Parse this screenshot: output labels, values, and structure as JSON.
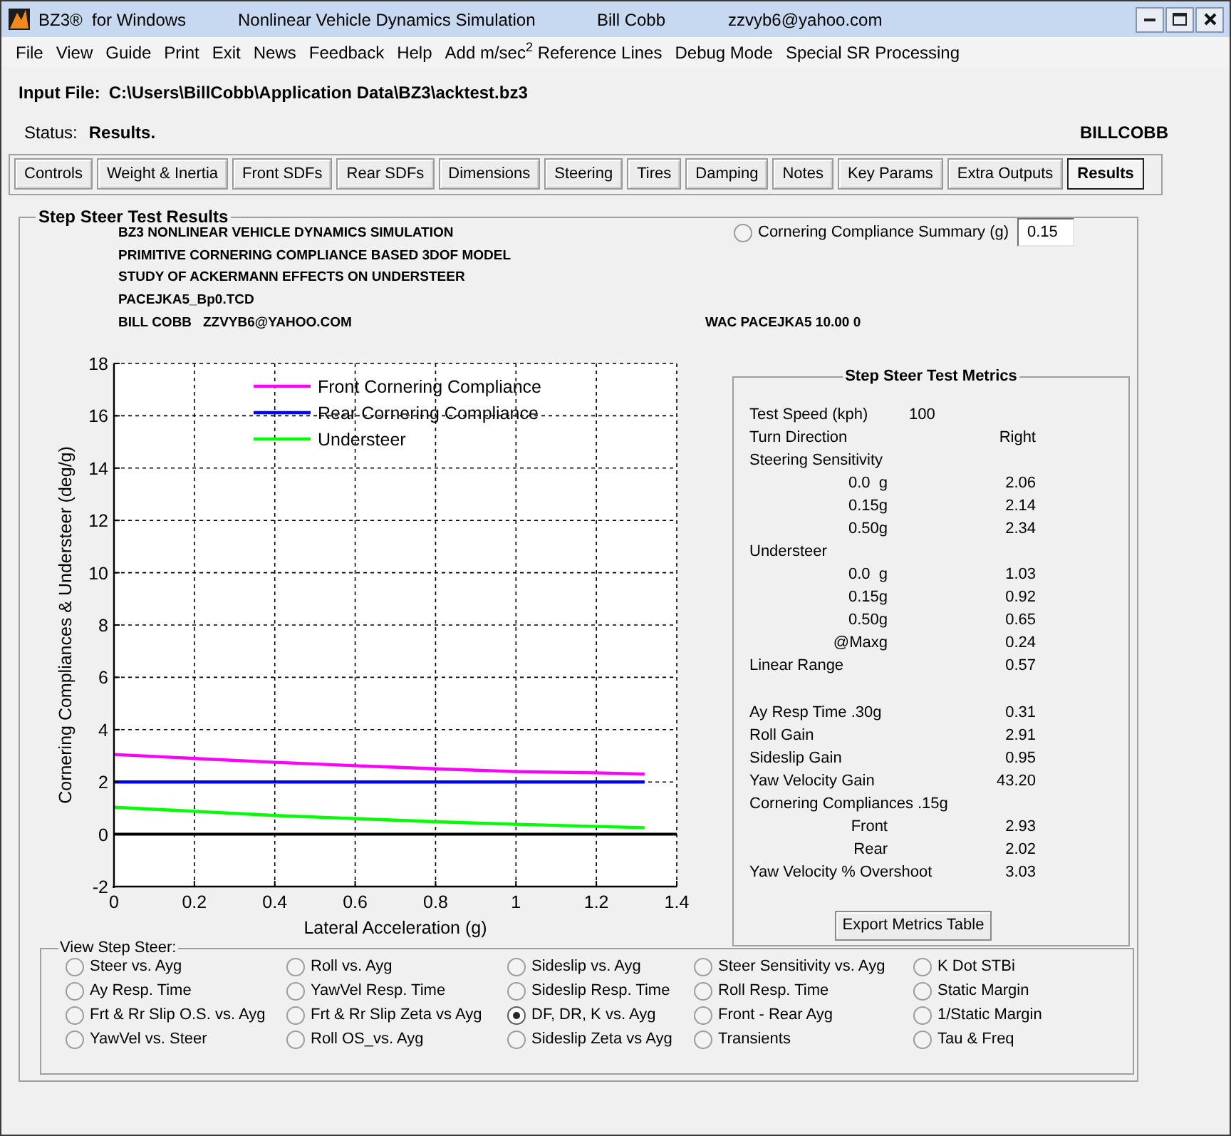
{
  "window": {
    "title_parts": [
      "BZ3®  for Windows",
      "Nonlinear Vehicle Dynamics Simulation",
      "Bill Cobb",
      "zzvyb6@yahoo.com"
    ]
  },
  "menu": [
    "File",
    "View",
    "Guide",
    "Print",
    "Exit",
    "News",
    "Feedback",
    "Help",
    "Add m/sec$^{2}$ Reference Lines",
    "Debug Mode",
    "Special SR Processing"
  ],
  "input_file": {
    "label": "Input File:",
    "path": "C:\\Users\\BillCobb\\Application Data\\BZ3\\acktest.bz3"
  },
  "status": {
    "label": "Status:",
    "value": "Results.",
    "user": "BILLCOBB"
  },
  "tabs": [
    {
      "label": "Controls",
      "selected": false
    },
    {
      "label": "Weight & Inertia",
      "selected": false
    },
    {
      "label": "Front SDFs",
      "selected": false
    },
    {
      "label": "Rear SDFs",
      "selected": false
    },
    {
      "label": "Dimensions",
      "selected": false
    },
    {
      "label": "Steering",
      "selected": false
    },
    {
      "label": "Tires",
      "selected": false
    },
    {
      "label": "Damping",
      "selected": false
    },
    {
      "label": "Notes",
      "selected": false
    },
    {
      "label": "Key Params",
      "selected": false
    },
    {
      "label": "Extra Outputs",
      "selected": false
    },
    {
      "label": "Results",
      "selected": true
    }
  ],
  "results_panel": {
    "title": "Step Steer Test Results",
    "header_lines": [
      "BZ3 NONLINEAR VEHICLE DYNAMICS SIMULATION",
      "PRIMITIVE CORNERING COMPLIANCE BASED 3DOF MODEL",
      "STUDY OF ACKERMANN EFFECTS ON UNDERSTEER",
      "PACEJKA5_Bp0.TCD",
      "BILL COBB   ZZVYB6@YAHOO.COM"
    ],
    "tire_info": "WAC PACEJKA5 10.00 0",
    "summary_option": {
      "label": "Cornering Compliance Summary (g)",
      "selected": false
    },
    "summary_value": "0.15",
    "chart_data": {
      "type": "line",
      "xlabel": "Lateral Acceleration (g)",
      "ylabel": "Cornering Compliances & Understeer (deg/g)",
      "x": [
        0,
        0.2,
        0.4,
        0.6,
        0.8,
        1,
        1.2,
        1.32
      ],
      "series": [
        {
          "name": "Front Cornering Compliance",
          "color": "#ff00ff",
          "values": [
            3.05,
            2.9,
            2.75,
            2.62,
            2.5,
            2.4,
            2.35,
            2.3
          ]
        },
        {
          "name": "Rear Cornering Compliance",
          "color": "#0000ff",
          "values": [
            2,
            2,
            2,
            2,
            2,
            2,
            2,
            2
          ]
        },
        {
          "name": "Understeer",
          "color": "#00ff00",
          "values": [
            1.03,
            0.88,
            0.72,
            0.6,
            0.48,
            0.38,
            0.3,
            0.25
          ]
        }
      ],
      "xlim": [
        0,
        1.4
      ],
      "ylim": [
        -2,
        18
      ],
      "xticks": [
        0,
        0.2,
        0.4,
        0.6,
        0.8,
        1,
        1.2,
        1.4
      ],
      "yticks": [
        -2,
        0,
        2,
        4,
        6,
        8,
        10,
        12,
        14,
        16,
        18
      ],
      "grid": true,
      "legend": "top",
      "ref_lines": [
        {
          "axis": "y",
          "value": 0
        }
      ]
    },
    "metrics": {
      "title": "Step Steer Test Metrics",
      "sections": [
        [
          {
            "kind": "inline",
            "label": "Test Speed (kph)",
            "value": "100"
          },
          {
            "kind": "value",
            "label": "Turn Direction",
            "value": "Right"
          },
          {
            "kind": "heading",
            "label": "Steering Sensitivity"
          },
          {
            "kind": "sub",
            "label": "0.0  g",
            "value": "2.06"
          },
          {
            "kind": "sub",
            "label": "0.15g",
            "value": "2.14"
          },
          {
            "kind": "sub",
            "label": "0.50g",
            "value": "2.34"
          },
          {
            "kind": "heading",
            "label": "Understeer"
          },
          {
            "kind": "sub",
            "label": "0.0  g",
            "value": "1.03"
          },
          {
            "kind": "sub",
            "label": "0.15g",
            "value": "0.92"
          },
          {
            "kind": "sub",
            "label": "0.50g",
            "value": "0.65"
          },
          {
            "kind": "sub",
            "label": "@Maxg",
            "value": "0.24"
          },
          {
            "kind": "value",
            "label": "Linear Range",
            "value": "0.57"
          }
        ],
        [
          {
            "kind": "value",
            "label": "Ay Resp Time .30g",
            "value": "0.31"
          },
          {
            "kind": "value",
            "label": "Roll Gain",
            "value": "2.91"
          },
          {
            "kind": "value",
            "label": "Sideslip Gain",
            "value": "0.95"
          },
          {
            "kind": "value",
            "label": "Yaw Velocity Gain",
            "value": "43.20"
          },
          {
            "kind": "heading",
            "label": "Cornering Compliances .15g"
          },
          {
            "kind": "sub",
            "label": "Front",
            "value": "2.93"
          },
          {
            "kind": "sub",
            "label": "Rear",
            "value": "2.02"
          },
          {
            "kind": "value",
            "label": "Yaw Velocity % Overshoot",
            "value": "3.03"
          }
        ]
      ],
      "export_button": "Export Metrics Table"
    },
    "view_options": {
      "title": "View Step Steer:",
      "options": [
        {
          "label": "Steer vs. Ayg",
          "selected": false
        },
        {
          "label": "Roll vs. Ayg",
          "selected": false
        },
        {
          "label": "Sideslip vs. Ayg",
          "selected": false
        },
        {
          "label": "Steer Sensitivity vs. Ayg",
          "selected": false
        },
        {
          "label": "K Dot STBi",
          "selected": false
        },
        {
          "label": "Ay Resp. Time",
          "selected": false
        },
        {
          "label": "YawVel Resp. Time",
          "selected": false
        },
        {
          "label": "Sideslip Resp. Time",
          "selected": false
        },
        {
          "label": "Roll Resp. Time",
          "selected": false
        },
        {
          "label": "Static Margin",
          "selected": false
        },
        {
          "label": "Frt & Rr Slip O.S. vs. Ayg",
          "selected": false
        },
        {
          "label": "Frt & Rr Slip Zeta vs Ayg",
          "selected": false
        },
        {
          "label": "DF, DR, K vs. Ayg",
          "selected": true
        },
        {
          "label": "Front - Rear Ayg",
          "selected": false
        },
        {
          "label": "1/Static Margin",
          "selected": false
        },
        {
          "label": "YawVel vs. Steer",
          "selected": false
        },
        {
          "label": "Roll OS_vs. Ayg",
          "selected": false
        },
        {
          "label": "Sideslip Zeta vs Ayg",
          "selected": false
        },
        {
          "label": "Transients",
          "selected": false
        },
        {
          "label": "Tau & Freq",
          "selected": false
        }
      ]
    }
  }
}
